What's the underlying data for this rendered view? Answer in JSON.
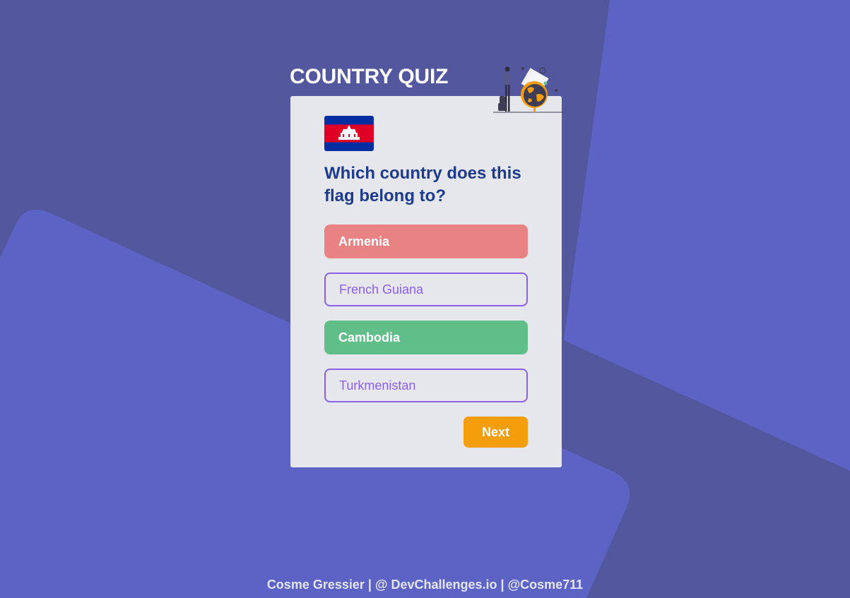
{
  "colors": {
    "background": "#52579e",
    "shape": "#5c63c4",
    "card": "#e6e7ec",
    "question": "#1e3a8a",
    "wrong": "#e98383",
    "correct": "#60bf88",
    "neutral_border": "#8a60e4",
    "next_button": "#f59e0b"
  },
  "header": {
    "title": "COUNTRY QUIZ",
    "illustration_icon": "traveler-globe-illustration"
  },
  "quiz": {
    "flag_icon": "cambodia-flag",
    "question": "Which country does this flag belong to?",
    "answers": [
      {
        "label": "Armenia",
        "state": "wrong"
      },
      {
        "label": "French Guiana",
        "state": "neutral"
      },
      {
        "label": "Cambodia",
        "state": "correct"
      },
      {
        "label": "Turkmenistan",
        "state": "neutral"
      }
    ],
    "next_label": "Next"
  },
  "footer": {
    "credit": "Cosme Gressier | @ DevChallenges.io | @Cosme711"
  }
}
